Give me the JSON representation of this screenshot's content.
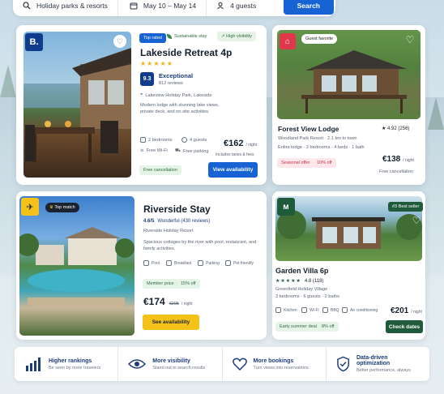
{
  "search": {
    "destination": "Holiday parks & resorts",
    "dates": "May 10 – May 14",
    "guests": "4 guests",
    "button": "Search"
  },
  "card1": {
    "brand_logo": "B.",
    "badge_top_rated": "Top rated",
    "badge_sustainable": "Sustainable stay",
    "badge_visibility": "High visibility",
    "title": "Lakeside Retreat 4p",
    "stars": "★★★★★",
    "score": "9.3",
    "score_label": "Exceptional",
    "reviews": "812 reviews",
    "location": "Lakeview Holiday Park, Lakeside",
    "description": "Modern lodge with stunning lake views, private deck, and on-site activities.",
    "amenities": [
      "2 bedrooms",
      "4 guests",
      "Free Wi-Fi",
      "Free parking"
    ],
    "price": "€162",
    "per": "/ night",
    "price_note": "Includes taxes & fees",
    "cancel": "Free cancellation",
    "cta": "View availability"
  },
  "card2": {
    "badge_guest": "Guest favorite",
    "title": "Forest View Lodge",
    "rating": "★ 4.92 (256)",
    "park_line": "Woodland Park Resort  ·  2.1 km to town",
    "details": "Entire lodge  ·  2 bedrooms  ·  4 beds  ·  1 bath",
    "offer": "Seasonal offer",
    "discount": "10% off",
    "price": "€138",
    "per": "/ night",
    "cancel": "Free cancellation"
  },
  "card3": {
    "badge_top_match": "Top match",
    "title": "Riverside Stay",
    "rating_num": "4.6/5",
    "rating_label": "Wonderful (430 reviews)",
    "park": "Riverside Holiday Resort",
    "description": "Spacious cottages by the river with pool, restaurant, and family activities.",
    "amenities": [
      "Pool",
      "Breakfast",
      "Parking",
      "Pet friendly"
    ],
    "member": "Member price",
    "member_discount": "15% off",
    "price": "€174",
    "old_price": "€205",
    "per": "/ night",
    "cta": "See availability"
  },
  "card4": {
    "badge_best": "#3 Best seller",
    "title": "Garden Villa 6p",
    "stars": "★★★★★",
    "rating": "4.8 (118)",
    "park": "Greenfield Holiday Village",
    "details": "3 bedrooms  ·  6 guests  ·  2 baths",
    "amenities": [
      "Kitchen",
      "Wi-Fi",
      "BBQ",
      "Air conditioning"
    ],
    "deal": "Early summer deal",
    "deal_discount": "8% off",
    "price": "€201",
    "per": "/ night",
    "cta": "Check dates"
  },
  "features": [
    {
      "title": "Higher rankings",
      "sub": "Be seen by more travelers"
    },
    {
      "title": "More visibility",
      "sub": "Stand out in search results"
    },
    {
      "title": "More bookings",
      "sub": "Turn views into reservations"
    },
    {
      "title": "Data-driven optimization",
      "sub": "Better performance, always"
    }
  ],
  "colors": {
    "booking_blue": "#1763d4",
    "airbnb_red": "#e0384a",
    "expedia_yellow": "#f5c21a",
    "green_brand": "#1f5a3a"
  }
}
